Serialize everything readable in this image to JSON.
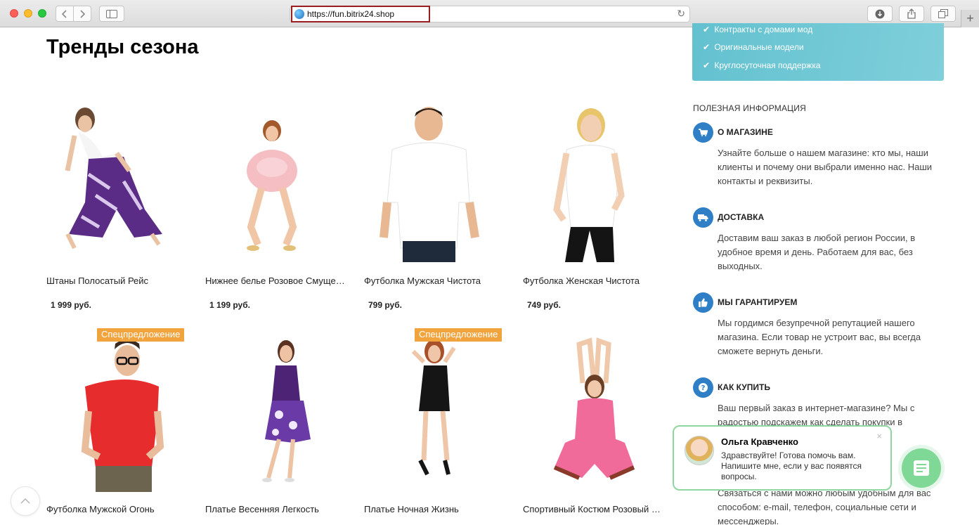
{
  "browser": {
    "url": "https://fun.bitrix24.shop",
    "icons": [
      "back-icon",
      "forward-icon",
      "sidebar-icon",
      "globe-icon",
      "reload-icon",
      "download-icon",
      "share-icon",
      "tabs-icon",
      "plus-icon"
    ]
  },
  "page": {
    "title": "Тренды сезона"
  },
  "products": [
    {
      "name": "Штаны Полосатый Рейс",
      "price": "1 999 руб.",
      "badge": ""
    },
    {
      "name": "Нижнее белье Розовое Смущение",
      "price": "1 199 руб.",
      "badge": ""
    },
    {
      "name": "Футболка Мужская Чистота",
      "price": "799 руб.",
      "badge": ""
    },
    {
      "name": "Футболка Женская Чистота",
      "price": "749 руб.",
      "badge": ""
    },
    {
      "name": "Футболка Мужской Огонь",
      "price": "",
      "badge": "Спецпредложение"
    },
    {
      "name": "Платье Весенняя Легкость",
      "price": "",
      "badge": ""
    },
    {
      "name": "Платье Ночная Жизнь",
      "price": "",
      "badge": "Спецпредложение"
    },
    {
      "name": "Спортивный Костюм Розовый Закат",
      "price": "",
      "badge": ""
    }
  ],
  "promo": {
    "items": [
      "Контракты с домами мод",
      "Оригинальные модели",
      "Круглосуточная поддержка"
    ]
  },
  "info": {
    "heading": "ПОЛЕЗНАЯ ИНФОРМАЦИЯ",
    "blocks": [
      {
        "icon": "cart-icon",
        "title": "О МАГАЗИНЕ",
        "text": "Узнайте больше о нашем магазине: кто мы, наши клиенты и почему они выбрали именно нас. Наши контакты и реквизиты."
      },
      {
        "icon": "truck-icon",
        "title": "ДОСТАВКА",
        "text": "Доставим ваш заказ в любой регион России, в удобное время и день. Работаем для вас, без выходных."
      },
      {
        "icon": "thumbs-up-icon",
        "title": "МЫ ГАРАНТИРУЕМ",
        "text": "Мы гордимся безупречной репутацией нашего магазина. Если товар не устроит вас, вы всегда сможете вернуть деньги."
      },
      {
        "icon": "question-icon",
        "title": "КАК КУПИТЬ",
        "text": "Ваш первый заказ в интернет-магазине? Мы с радостью подскажем как сделать покупки в"
      }
    ],
    "contact_text": "Связаться с нами можно любым удобным для вас способом: e-mail, телефон, социальные сети и мессенджеры."
  },
  "chat": {
    "name": "Ольга Кравченко",
    "message": "Здравствуйте! Готова помочь вам. Напишите мне, если у вас появятся вопросы.",
    "close": "×"
  },
  "colors": {
    "accent": "#2f7fc6",
    "badge": "#f1a43e",
    "promo": "#63c1cf",
    "chat": "#7fd896"
  }
}
